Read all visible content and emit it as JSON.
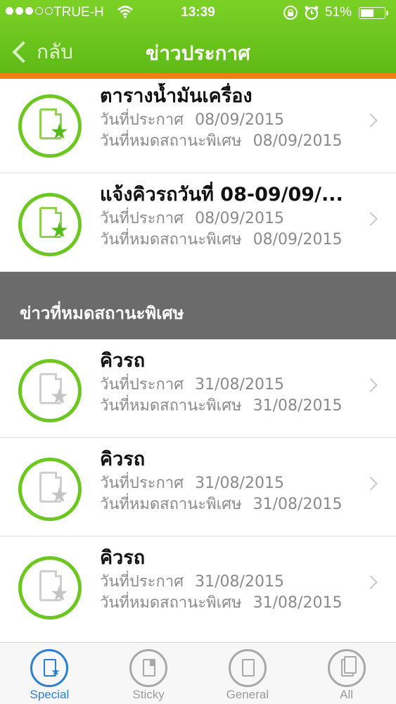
{
  "status_bar": {
    "carrier": "TRUE-H",
    "time": "13:39",
    "battery": "51%",
    "battery_level": 0.51,
    "signal_filled": 3,
    "signal_total": 5
  },
  "nav": {
    "back_label": "กลับ",
    "title": "ข่าวประกาศ"
  },
  "labels": {
    "announce_date": "วันที่ประกาศ",
    "special_end_date": "วันที่หมดสถานะพิเศษ"
  },
  "active_items": [
    {
      "title": "ตารางน้ำมันเครื่อง",
      "announce_date": "08/09/2015",
      "end_date": "08/09/2015"
    },
    {
      "title": "แจ้งคิวรถวันที่ 08-09/09/...",
      "announce_date": "08/09/2015",
      "end_date": "08/09/2015"
    }
  ],
  "expired_section": {
    "title": "ข่าวที่หมดสถานะพิเศษ",
    "items": [
      {
        "title": "คิวรถ",
        "announce_date": "31/08/2015",
        "end_date": "31/08/2015"
      },
      {
        "title": "คิวรถ",
        "announce_date": "31/08/2015",
        "end_date": "31/08/2015"
      },
      {
        "title": "คิวรถ",
        "announce_date": "31/08/2015",
        "end_date": "31/08/2015"
      }
    ]
  },
  "tabs": [
    {
      "label": "Special",
      "icon": "special-news-icon",
      "active": true
    },
    {
      "label": "Sticky",
      "icon": "sticky-news-icon",
      "active": false
    },
    {
      "label": "General",
      "icon": "general-news-icon",
      "active": false
    },
    {
      "label": "All",
      "icon": "all-news-icon",
      "active": false
    }
  ],
  "colors": {
    "header_green": "#6cc820",
    "accent_orange": "#f07f16",
    "section_gray": "#6b6b6b",
    "tab_active_blue": "#2a7fd4"
  }
}
